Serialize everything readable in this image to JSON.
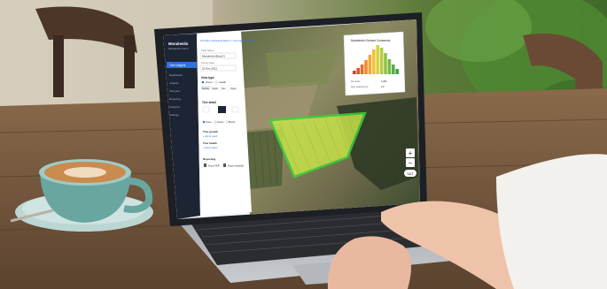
{
  "app": {
    "brand_line1": "Moraitenlin",
    "brand_line2": "Moraitenlin Farm",
    "nav_active": "Tree Insights",
    "nav_items": [
      "Dashboard",
      "Insights",
      "Vineyard",
      "Reporting",
      "Analytics",
      "Settings"
    ],
    "breadcrumb": "All Fields / Moraitenlin Block 1 / Tree Insights analysis"
  },
  "panel": {
    "field_label": "Field Name",
    "field_value": "Moraitenlin Block D",
    "date_label": "Survey date",
    "date_value": "22 Dec 2021",
    "view_section": "View type",
    "view_options": [
      "Green",
      "Health"
    ],
    "tabs": [
      "Density",
      "Height",
      "Size",
      "Vigour"
    ],
    "tree_section": "Tree detail",
    "colour_options": [
      "Green",
      "Colour",
      "Blocks"
    ],
    "tree_growth": "Tree growth",
    "tree_growth_link": "+ Add to report",
    "tree_health": "Tree health",
    "tree_health_link": "+ Add to report",
    "reporting": "Reporting",
    "export_pdf": "Export PDF",
    "export_shapefile": "Export shapefile"
  },
  "popup": {
    "title": "Moraitenlin Orchard Comments",
    "row1_label": "No. trees",
    "row1_value": "1,254",
    "row2_label": "Avg. spacing (m)",
    "row2_value": "4.2"
  },
  "map_controls": {
    "zoom_in": "+",
    "zoom_out": "−",
    "help": "?",
    "mode": "SAT"
  },
  "colors": {
    "accent": "#2f6fdf",
    "sidebar": "#1d2433",
    "field_fill": "#c7e24a",
    "field_border": "#3ad43a"
  }
}
